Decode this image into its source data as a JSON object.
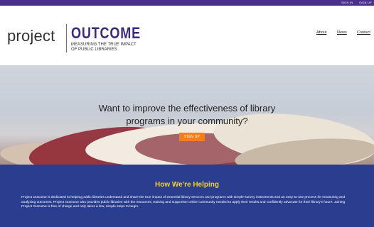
{
  "topbar": {
    "signin": "SIGN IN",
    "signup": "SIGN UP"
  },
  "logo": {
    "project": "project",
    "outcome": "OUTCOME",
    "tagline_1": "MEASURING THE TRUE IMPACT",
    "tagline_2": "OF PUBLIC LIBRARIES"
  },
  "nav": {
    "about": "About",
    "news": "News",
    "contact": "Contact"
  },
  "hero": {
    "line1": "Want to improve the effectiveness of library",
    "line2": "programs in your community?",
    "button": "SIGN UP"
  },
  "helping": {
    "title": "How We're Helping",
    "text": "Project Outcome is dedicated to helping public libraries understand and share the true impact of essential library services and programs with simple-survey instruments and an easy-to-use process for measuring and analyzing outcomes. Project Outcome also provides public libraries with the resources, training and supportive online community needed to apply their results and confidently advocate for their library's future. Joining Project Outcome is free of charge and only takes a few, simple steps to begin."
  },
  "colors": {
    "purple": "#4a2f8c",
    "outcome": "#3d2a7e",
    "orange": "#f07f1f",
    "navy": "#2a3d8f",
    "gold": "#f4d12a"
  }
}
